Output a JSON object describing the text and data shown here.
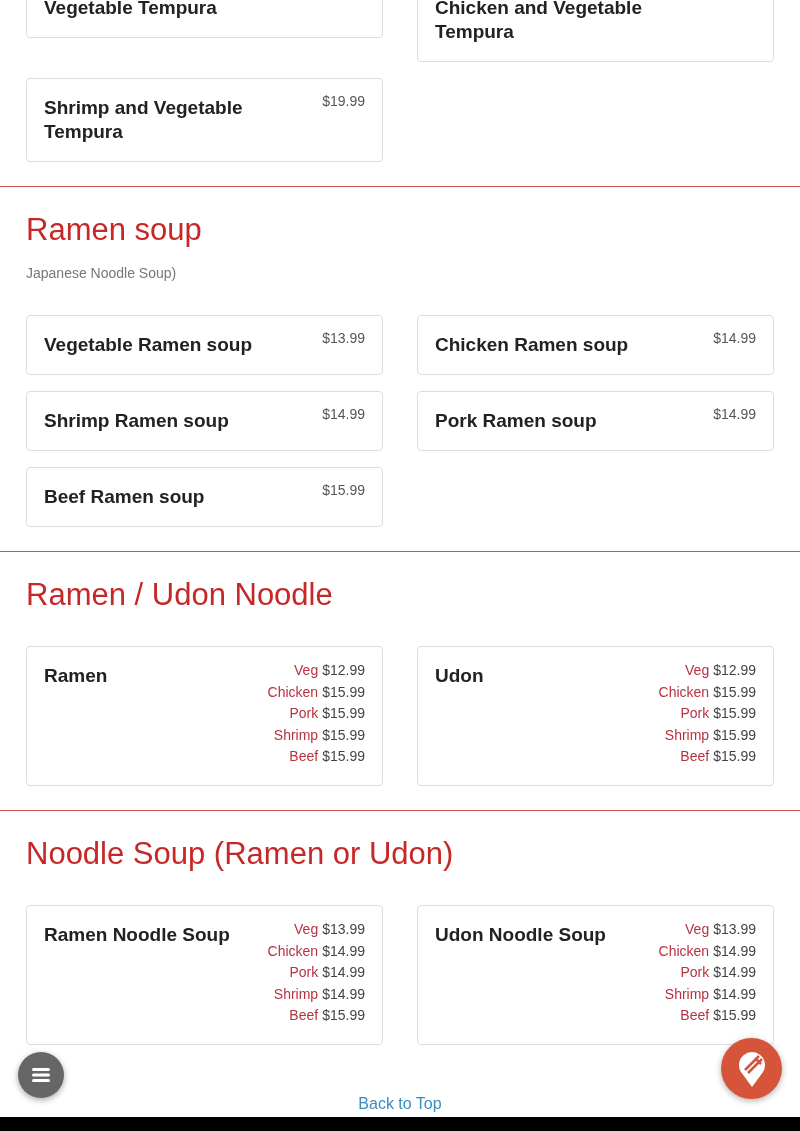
{
  "sections": [
    {
      "items": [
        {
          "kind": "single",
          "name": "Vegetable Tempura"
        },
        {
          "kind": "single",
          "name": "Chicken and Vegetable Tempura"
        },
        {
          "kind": "single",
          "name": "Shrimp and Vegetable Tempura",
          "price": "$19.99"
        }
      ]
    },
    {
      "title": "Ramen soup",
      "subtitle": "Japanese Noodle Soup)",
      "items": [
        {
          "kind": "single",
          "name": "Vegetable Ramen soup",
          "price": "$13.99"
        },
        {
          "kind": "single",
          "name": "Chicken Ramen soup",
          "price": "$14.99"
        },
        {
          "kind": "single",
          "name": "Shrimp Ramen soup",
          "price": "$14.99"
        },
        {
          "kind": "single",
          "name": "Pork Ramen soup",
          "price": "$14.99"
        },
        {
          "kind": "single",
          "name": "Beef Ramen soup",
          "price": "$15.99"
        }
      ]
    },
    {
      "title": "Ramen / Udon Noodle",
      "items": [
        {
          "kind": "variants",
          "name": "Ramen",
          "variants": [
            {
              "label": "Veg",
              "price": "$12.99"
            },
            {
              "label": "Chicken",
              "price": "$15.99"
            },
            {
              "label": "Pork",
              "price": "$15.99"
            },
            {
              "label": "Shrimp",
              "price": "$15.99"
            },
            {
              "label": "Beef",
              "price": "$15.99"
            }
          ]
        },
        {
          "kind": "variants",
          "name": "Udon",
          "variants": [
            {
              "label": "Veg",
              "price": "$12.99"
            },
            {
              "label": "Chicken",
              "price": "$15.99"
            },
            {
              "label": "Pork",
              "price": "$15.99"
            },
            {
              "label": "Shrimp",
              "price": "$15.99"
            },
            {
              "label": "Beef",
              "price": "$15.99"
            }
          ]
        }
      ]
    },
    {
      "title": "Noodle Soup (Ramen or Udon)",
      "items": [
        {
          "kind": "variants",
          "name": "Ramen Noodle Soup",
          "variants": [
            {
              "label": "Veg",
              "price": "$13.99"
            },
            {
              "label": "Chicken",
              "price": "$14.99"
            },
            {
              "label": "Pork",
              "price": "$14.99"
            },
            {
              "label": "Shrimp",
              "price": "$14.99"
            },
            {
              "label": "Beef",
              "price": "$15.99"
            }
          ]
        },
        {
          "kind": "variants",
          "name": "Udon Noodle Soup",
          "variants": [
            {
              "label": "Veg",
              "price": "$13.99"
            },
            {
              "label": "Chicken",
              "price": "$14.99"
            },
            {
              "label": "Pork",
              "price": "$14.99"
            },
            {
              "label": "Shrimp",
              "price": "$14.99"
            },
            {
              "label": "Beef",
              "price": "$15.99"
            }
          ]
        }
      ]
    }
  ],
  "back_to_top": "Back to Top"
}
